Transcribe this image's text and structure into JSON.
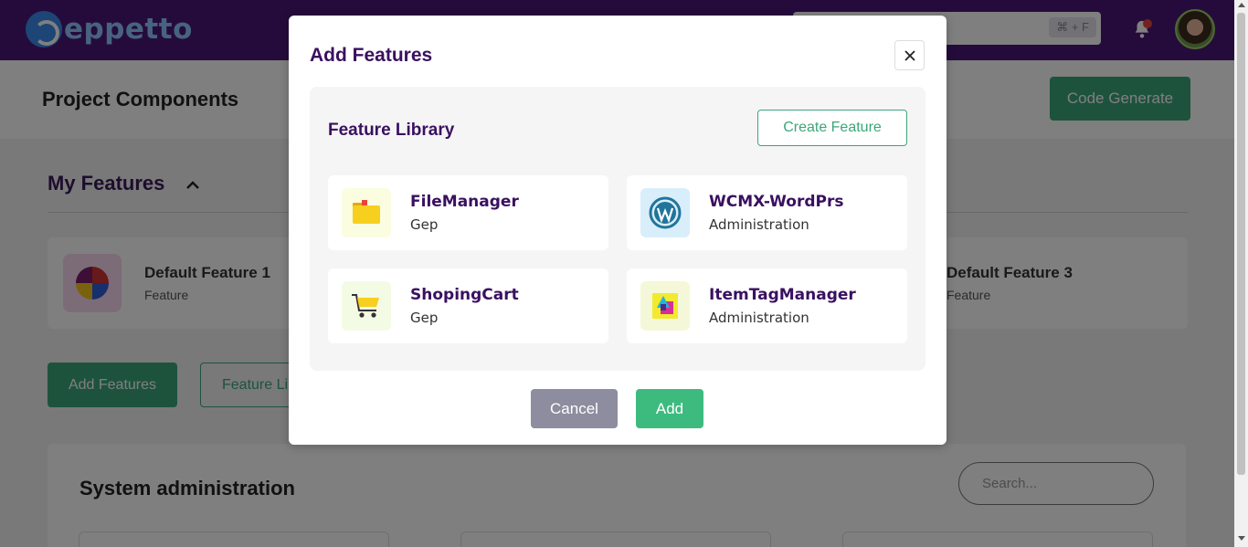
{
  "topbar": {
    "logo_text": "eppetto",
    "search_shortcut": "⌘ + F",
    "notification_indicator": true
  },
  "page": {
    "title": "Project Components",
    "code_generate_label": "Code Generate",
    "my_features": {
      "title": "My Features",
      "cards": [
        {
          "title": "Default Feature 1",
          "subtitle": "Feature"
        },
        {
          "title": "Default Feature 3",
          "subtitle": "Feature"
        }
      ]
    },
    "add_features_label": "Add Features",
    "feature_library_label": "Feature Li",
    "system_admin": {
      "title": "System administration",
      "search_placeholder": "Search..."
    }
  },
  "modal": {
    "title": "Add Features",
    "library": {
      "title": "Feature Library",
      "create_label": "Create Feature",
      "items": [
        {
          "name": "FileManager",
          "category": "Gep",
          "icon": "folder-icon",
          "icon_bg": "#fbfde0"
        },
        {
          "name": "WCMX-WordPrs",
          "category": "Administration",
          "icon": "wordpress-icon",
          "icon_bg": "#d9eefb"
        },
        {
          "name": "ShopingCart",
          "category": "Gep",
          "icon": "cart-icon",
          "icon_bg": "#f3fbe4"
        },
        {
          "name": "ItemTagManager",
          "category": "Administration",
          "icon": "tag-manager-icon",
          "icon_bg": "#f5f8d8"
        }
      ]
    },
    "cancel_label": "Cancel",
    "add_label": "Add"
  },
  "colors": {
    "topbar": "#4b1676",
    "primary_green": "#3aa77a",
    "heading_purple": "#3a1060"
  }
}
